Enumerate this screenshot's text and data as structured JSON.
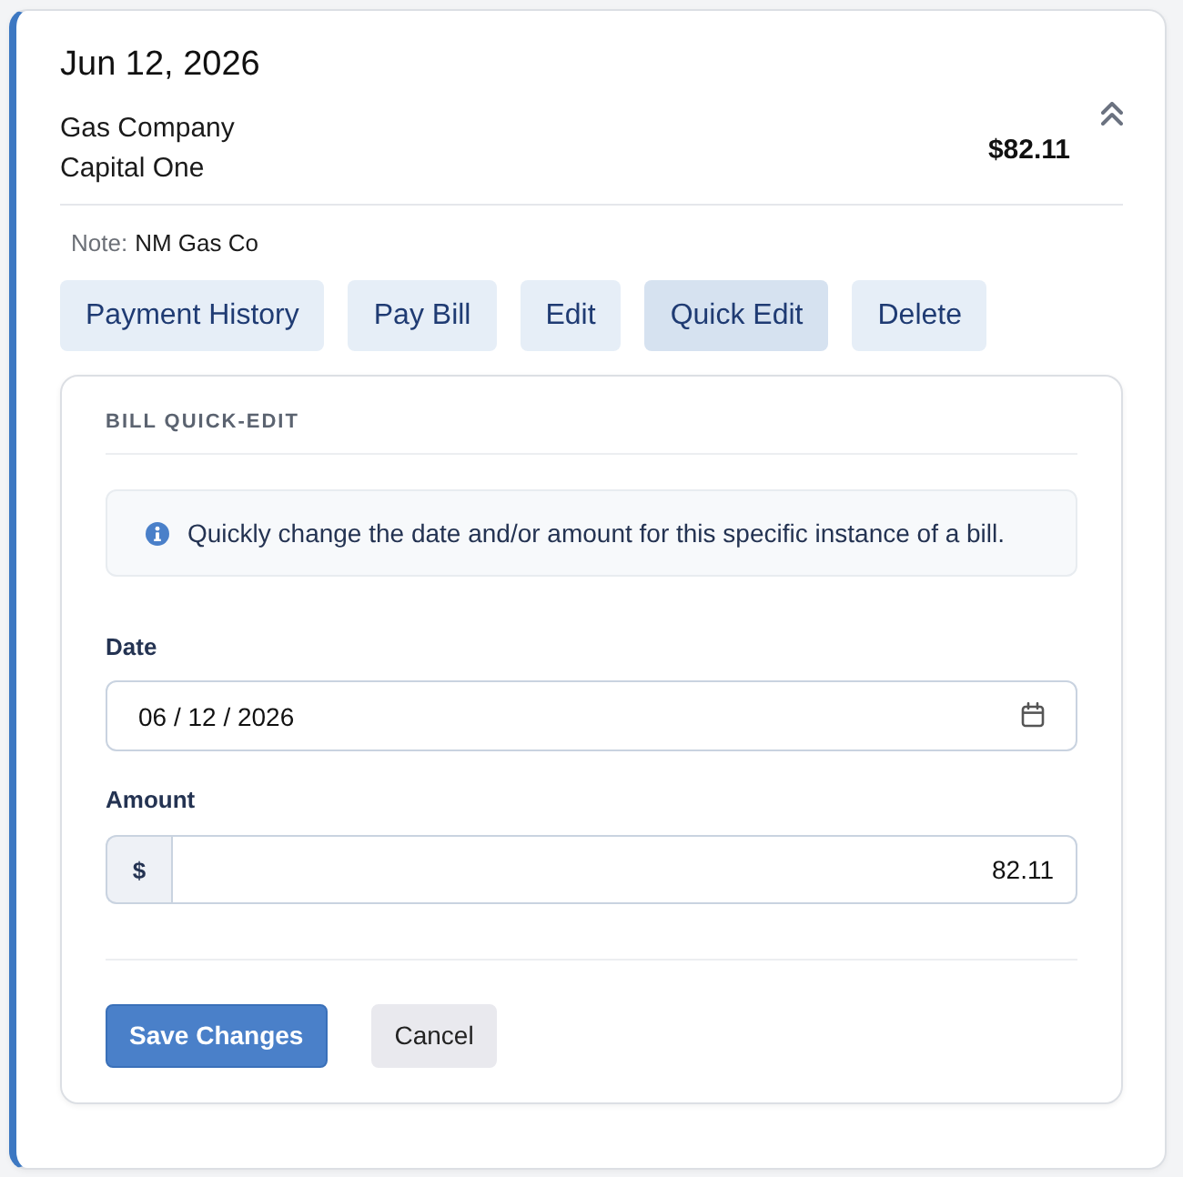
{
  "bill": {
    "date": "Jun 12, 2026",
    "payee": "Gas Company",
    "account": "Capital One",
    "amount": "$82.11",
    "expanded": true,
    "note": {
      "label": "Note:",
      "text": "NM Gas Co"
    },
    "actions": [
      {
        "label": "Payment History",
        "selected": false
      },
      {
        "label": "Pay Bill",
        "selected": false
      },
      {
        "label": "Edit",
        "selected": false
      },
      {
        "label": "Quick Edit",
        "selected": true
      },
      {
        "label": "Delete",
        "selected": false
      }
    ]
  },
  "quick_edit": {
    "title": "BILL QUICK-EDIT",
    "info": "Quickly change the date and/or amount for this specific instance of a bill.",
    "fields": [
      {
        "kind": "date",
        "label": "Date",
        "value": "06 / 12 / 2026"
      },
      {
        "kind": "currency",
        "label": "Amount",
        "prefix": "$",
        "value": "82.11"
      }
    ],
    "buttons": [
      {
        "kind": "primary",
        "label": "Save Changes"
      },
      {
        "kind": "secondary",
        "label": "Cancel"
      }
    ]
  }
}
